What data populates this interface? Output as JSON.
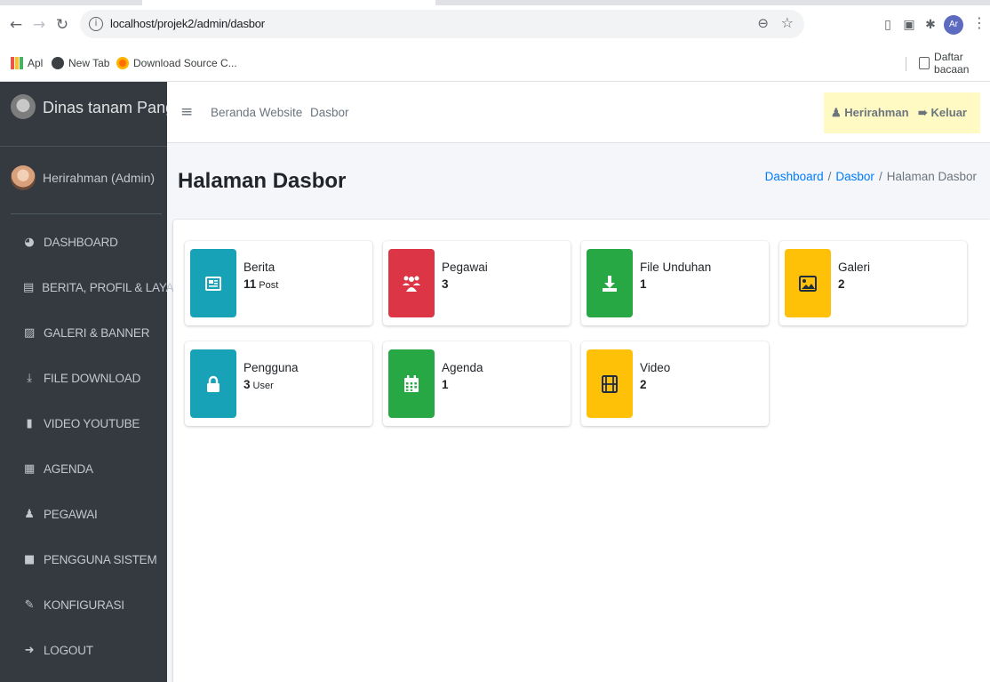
{
  "browser": {
    "url": "localhost/projek2/admin/dasbor",
    "profile_initials": "Ar",
    "bookmarks": [
      "Apl",
      "New Tab",
      "Download Source C..."
    ],
    "reading_list": "Daftar bacaan"
  },
  "brand": {
    "name": "Dinas tanam Pangan Hortikultura"
  },
  "user_panel": {
    "name": "Herirahman (Admin)"
  },
  "sidebar": {
    "items": [
      {
        "label": "DASHBOARD",
        "icon": "dashboard-icon"
      },
      {
        "label": "BERITA, PROFIL & LAYANAN",
        "icon": "newspaper-icon"
      },
      {
        "label": "GALERI & BANNER",
        "icon": "image-icon"
      },
      {
        "label": "FILE DOWNLOAD",
        "icon": "download-icon"
      },
      {
        "label": "VIDEO YOUTUBE",
        "icon": "youtube-icon"
      },
      {
        "label": "AGENDA",
        "icon": "calendar-icon"
      },
      {
        "label": "PEGAWAI",
        "icon": "users-icon"
      },
      {
        "label": "PENGGUNA SISTEM",
        "icon": "lock-icon"
      },
      {
        "label": "KONFIGURASI",
        "icon": "wrench-icon"
      },
      {
        "label": "LOGOUT",
        "icon": "sign-out-icon"
      }
    ]
  },
  "navbar": {
    "links": [
      "Beranda Website",
      "Dasbor"
    ],
    "user": "Herirahman",
    "logout": "Keluar"
  },
  "header": {
    "title": "Halaman Dasbor",
    "breadcrumb": [
      "Dashboard",
      "Dasbor",
      "Halaman Dasbor"
    ]
  },
  "info_boxes": [
    {
      "label": "Berita",
      "count": "11",
      "unit": "Post",
      "color": "#17a2b8",
      "icon": "newspaper-icon"
    },
    {
      "label": "Pegawai",
      "count": "3",
      "unit": "",
      "color": "#dc3545",
      "icon": "users-icon"
    },
    {
      "label": "File Unduhan",
      "count": "1",
      "unit": "",
      "color": "#28a745",
      "icon": "download-icon"
    },
    {
      "label": "Galeri",
      "count": "2",
      "unit": "",
      "color": "#ffc107",
      "icon": "image-icon"
    },
    {
      "label": "Pengguna",
      "count": "3",
      "unit": "User",
      "color": "#17a2b8",
      "icon": "lock-icon"
    },
    {
      "label": "Agenda",
      "count": "1",
      "unit": "",
      "color": "#28a745",
      "icon": "calendar-icon"
    },
    {
      "label": "Video",
      "count": "2",
      "unit": "",
      "color": "#ffc107",
      "icon": "film-icon"
    }
  ]
}
